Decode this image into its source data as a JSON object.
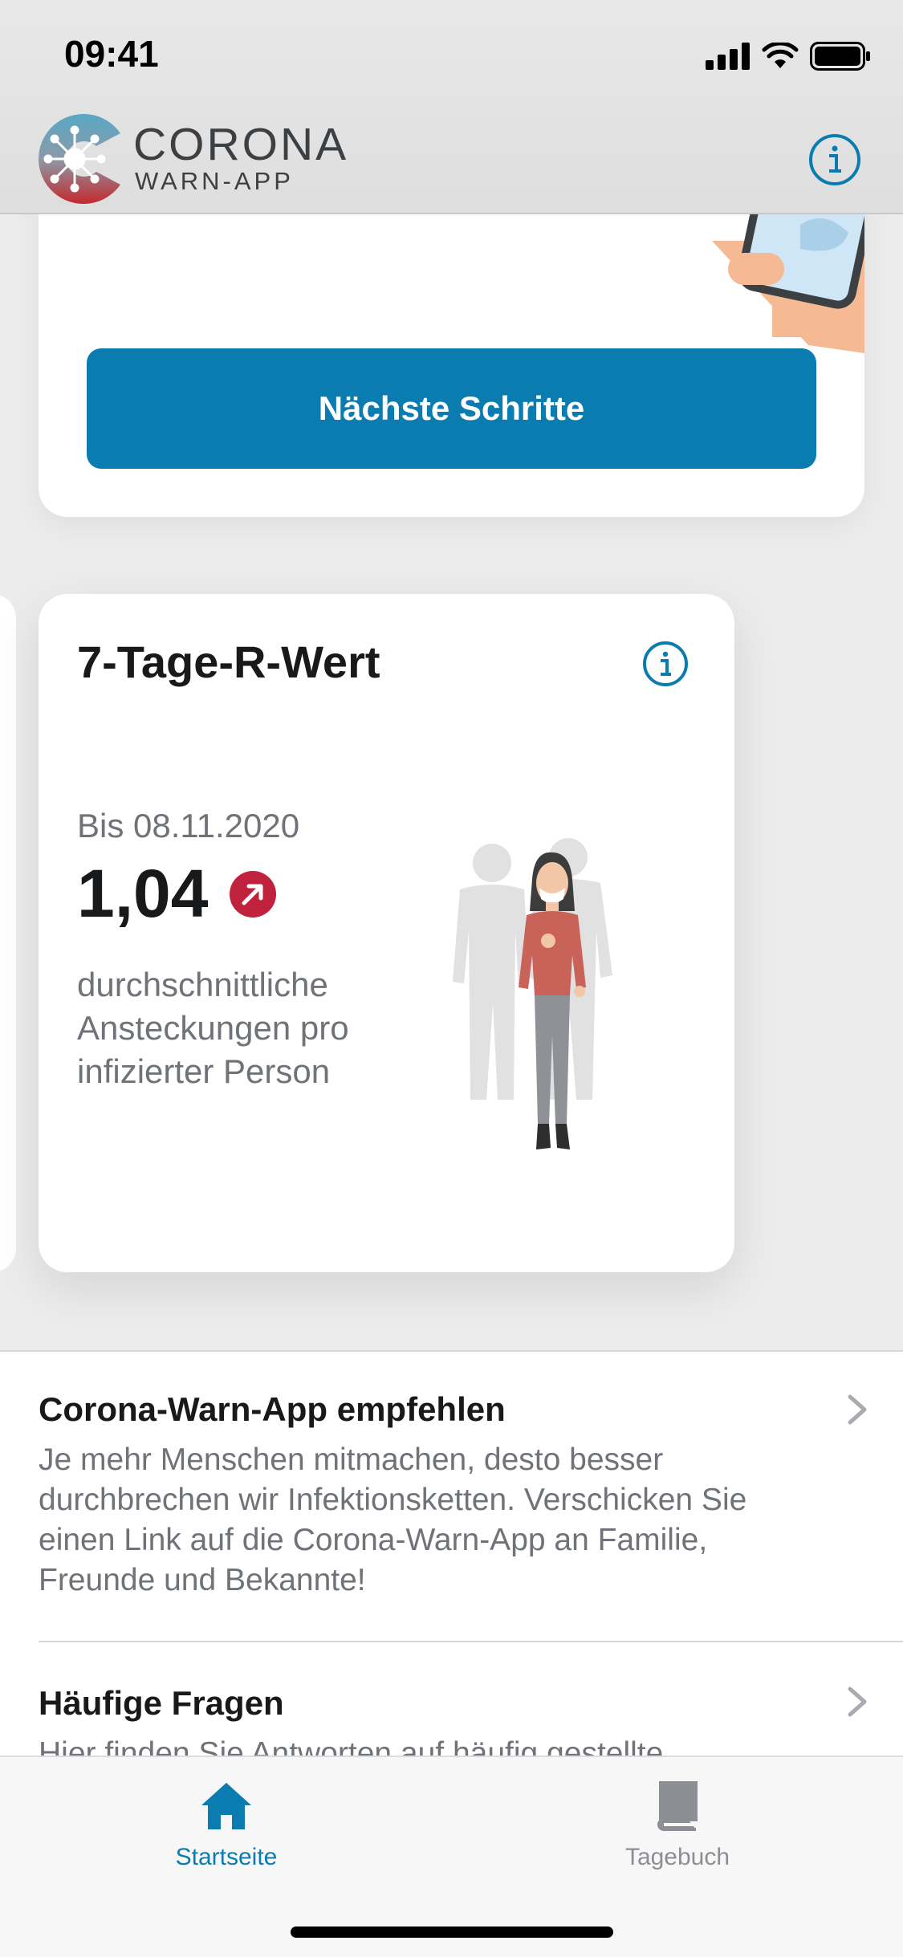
{
  "status_bar": {
    "time": "09:41"
  },
  "header": {
    "logo_title": "CORONA",
    "logo_subtitle": "WARN-APP",
    "info_icon": "info-icon"
  },
  "result_card": {
    "button_label": "Nächste Schritte"
  },
  "r_value_card": {
    "title": "7-Tage-R-Wert",
    "date_label": "Bis 08.11.2020",
    "value": "1,04",
    "trend": "increasing",
    "description": "durchschnittliche Ansteckungen pro infizierter Person"
  },
  "list": {
    "items": [
      {
        "title": "Corona-Warn-App empfehlen",
        "text": "Je mehr Menschen mitmachen, desto besser durchbrechen wir Infektionsketten. Verschicken Sie einen Link auf die Corona-Warn-App an Familie, Freunde und Bekannte!"
      },
      {
        "title": "Häufige Fragen",
        "text": "Hier finden Sie Antworten auf häufig gestellte"
      }
    ]
  },
  "tab_bar": {
    "tabs": [
      {
        "label": "Startseite",
        "icon": "home-icon",
        "active": true
      },
      {
        "label": "Tagebuch",
        "icon": "book-icon",
        "active": false
      }
    ]
  },
  "colors": {
    "accent": "#0a7caf",
    "trend_red": "#c0213c",
    "text_primary": "#17191a",
    "text_secondary": "#6f7378"
  }
}
